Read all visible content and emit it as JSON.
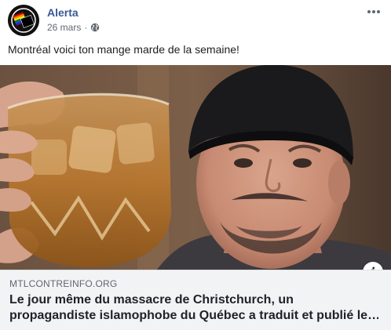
{
  "post": {
    "author": "Alerta",
    "date": "26 mars",
    "separator": "·",
    "privacy_icon": "globe-icon",
    "more_icon": "more-options-icon",
    "text": "Montréal voici ton mange marde de la semaine!"
  },
  "link_preview": {
    "domain": "MTLCONTREINFO.ORG",
    "headline_line1": "Le jour même du massacre de Christchurch, un",
    "headline_line2": "propagandiste islamophobe du Québec a traduit et publié le…",
    "info_icon": "info-icon",
    "info_glyph": "i"
  },
  "colors": {
    "author_link": "#385898",
    "meta_gray": "#616770",
    "preview_bg": "#f2f3f5"
  }
}
